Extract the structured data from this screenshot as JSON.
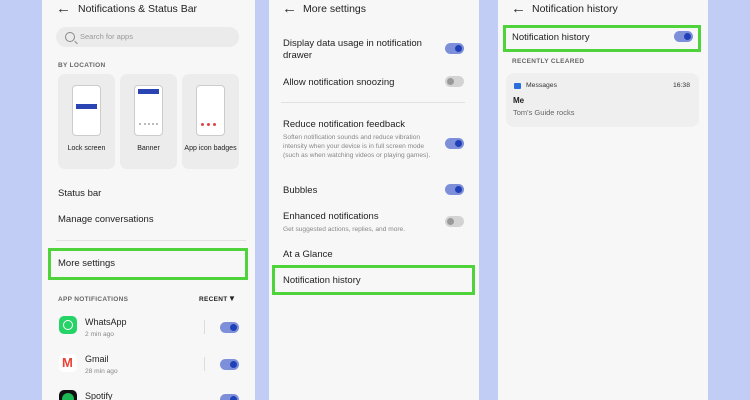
{
  "panel1": {
    "title": "Notifications & Status Bar",
    "search_placeholder": "Search for apps",
    "section_location": "BY LOCATION",
    "cards": [
      "Lock screen",
      "Banner",
      "App icon badges"
    ],
    "items": [
      "Status bar",
      "Manage conversations",
      "More settings"
    ],
    "section_apps": "APP NOTIFICATIONS",
    "sort_label": "RECENT",
    "apps": [
      {
        "name": "WhatsApp",
        "time": "2 min ago",
        "enabled": true
      },
      {
        "name": "Gmail",
        "time": "28 min ago",
        "enabled": true
      },
      {
        "name": "Spotify",
        "time": "",
        "enabled": true
      }
    ]
  },
  "panel2": {
    "title": "More settings",
    "display_usage": "Display data usage in notification drawer",
    "allow_snoozing": "Allow notification snoozing",
    "reduce_feedback": "Reduce notification feedback",
    "reduce_feedback_desc": "Soften notification sounds and reduce vibration intensity when your device is in full screen mode (such as when watching videos or playing games).",
    "bubbles": "Bubbles",
    "enhanced": "Enhanced notifications",
    "enhanced_desc": "Get suggested actions, replies, and more.",
    "at_a_glance": "At a Glance",
    "notification_history": "Notification history",
    "toggles": {
      "display_usage": true,
      "snoozing": false,
      "reduce_feedback": true,
      "bubbles": true,
      "enhanced": false
    }
  },
  "panel3": {
    "title": "Notification history",
    "history_toggle_label": "Notification history",
    "history_enabled": true,
    "section": "RECENTLY CLEARED",
    "notification": {
      "app": "Messages",
      "time": "16:38",
      "sender": "Me",
      "message": "Tom's Guide rocks"
    }
  },
  "colors": {
    "highlight": "#4fd33a",
    "toggle_on": "#2040b8",
    "background": "#c2cdf6"
  }
}
